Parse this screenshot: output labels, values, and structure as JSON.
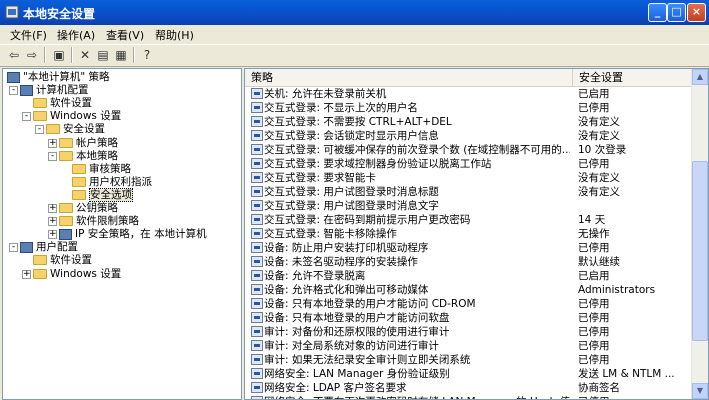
{
  "window": {
    "title": "本地安全设置"
  },
  "menu": [
    "文件(F)",
    "操作(A)",
    "查看(V)",
    "帮助(H)"
  ],
  "tree": [
    {
      "label": "\"本地计算机\" 策略",
      "indent": 0,
      "icon": "policy",
      "expander": ""
    },
    {
      "label": "计算机配置",
      "indent": 1,
      "icon": "computer",
      "expander": "-"
    },
    {
      "label": "软件设置",
      "indent": 2,
      "icon": "folder",
      "expander": ""
    },
    {
      "label": "Windows 设置",
      "indent": 2,
      "icon": "folder",
      "expander": "-"
    },
    {
      "label": "安全设置",
      "indent": 3,
      "icon": "folder",
      "expander": "-"
    },
    {
      "label": "帐户策略",
      "indent": 4,
      "icon": "folder",
      "expander": "+"
    },
    {
      "label": "本地策略",
      "indent": 4,
      "icon": "folder",
      "expander": "-"
    },
    {
      "label": "审核策略",
      "indent": 5,
      "icon": "folder",
      "expander": ""
    },
    {
      "label": "用户权利指派",
      "indent": 5,
      "icon": "folder",
      "expander": ""
    },
    {
      "label": "安全选项",
      "indent": 5,
      "icon": "folder",
      "expander": "",
      "selected": true
    },
    {
      "label": "公钥策略",
      "indent": 4,
      "icon": "folder",
      "expander": "+"
    },
    {
      "label": "软件限制策略",
      "indent": 4,
      "icon": "folder",
      "expander": "+"
    },
    {
      "label": "IP 安全策略，在 本地计算机",
      "indent": 4,
      "icon": "shield",
      "expander": "+"
    },
    {
      "label": "用户配置",
      "indent": 1,
      "icon": "user",
      "expander": "-"
    },
    {
      "label": "软件设置",
      "indent": 2,
      "icon": "folder",
      "expander": ""
    },
    {
      "label": "Windows 设置",
      "indent": 2,
      "icon": "folder",
      "expander": "+"
    }
  ],
  "columns": {
    "policy": "策略",
    "setting": "安全设置"
  },
  "rows": [
    {
      "policy": "关机: 允许在未登录前关机",
      "setting": "已启用"
    },
    {
      "policy": "交互式登录: 不显示上次的用户名",
      "setting": "已停用"
    },
    {
      "policy": "交互式登录: 不需要按 CTRL+ALT+DEL",
      "setting": "没有定义"
    },
    {
      "policy": "交互式登录: 会话锁定时显示用户信息",
      "setting": "没有定义"
    },
    {
      "policy": "交互式登录: 可被缓冲保存的前次登录个数 (在域控制器不可用的...",
      "setting": "10 次登录"
    },
    {
      "policy": "交互式登录: 要求域控制器身份验证以脱离工作站",
      "setting": "已停用"
    },
    {
      "policy": "交互式登录: 要求智能卡",
      "setting": "没有定义"
    },
    {
      "policy": "交互式登录: 用户试图登录时消息标题",
      "setting": "没有定义"
    },
    {
      "policy": "交互式登录: 用户试图登录时消息文字",
      "setting": ""
    },
    {
      "policy": "交互式登录: 在密码到期前提示用户更改密码",
      "setting": "14 天"
    },
    {
      "policy": "交互式登录: 智能卡移除操作",
      "setting": "无操作"
    },
    {
      "policy": "设备: 防止用户安装打印机驱动程序",
      "setting": "已停用"
    },
    {
      "policy": "设备: 未签名驱动程序的安装操作",
      "setting": "默认继续"
    },
    {
      "policy": "设备: 允许不登录脱离",
      "setting": "已启用"
    },
    {
      "policy": "设备: 允许格式化和弹出可移动媒体",
      "setting": "Administrators"
    },
    {
      "policy": "设备: 只有本地登录的用户才能访问 CD-ROM",
      "setting": "已停用"
    },
    {
      "policy": "设备: 只有本地登录的用户才能访问软盘",
      "setting": "已停用"
    },
    {
      "policy": "审计: 对备份和还原权限的使用进行审计",
      "setting": "已停用"
    },
    {
      "policy": "审计: 对全局系统对象的访问进行审计",
      "setting": "已停用"
    },
    {
      "policy": "审计: 如果无法纪录安全审计则立即关闭系统",
      "setting": "已停用"
    },
    {
      "policy": "网络安全: LAN Manager 身份验证级别",
      "setting": "发送 LM & NTLM ..."
    },
    {
      "policy": "网络安全: LDAP 客户签名要求",
      "setting": "协商签名"
    },
    {
      "policy": "网络安全: 不要在下次更改密码时存储 LAN Manager 的 Hash 值",
      "setting": "已停用"
    }
  ]
}
